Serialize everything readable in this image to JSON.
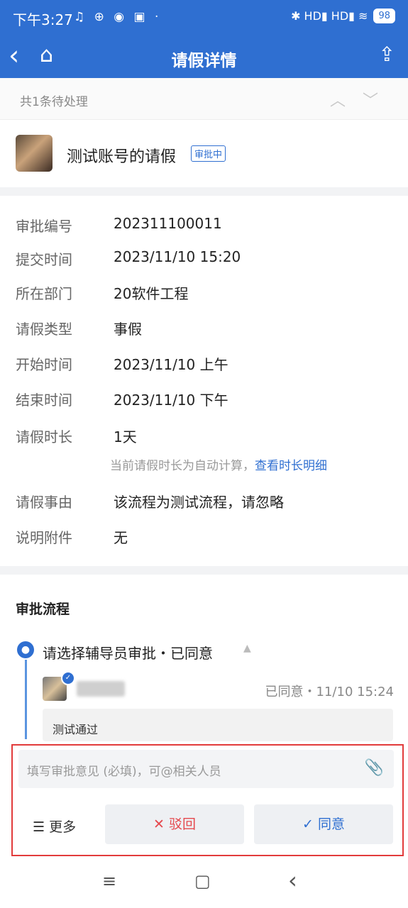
{
  "status_bar": {
    "time": "下午3:27",
    "left_icons": "♫ ⊕ ◉ ▣ ·",
    "right_icons": "✱ HD▮ HD▮ ≋",
    "battery": "98"
  },
  "header": {
    "title": "请假详情",
    "back_icon": "‹",
    "home_icon": "⌂",
    "share_icon": "⇪"
  },
  "pending": {
    "text": "共1条待处理",
    "up_icon": "︿",
    "down_icon": "﹀"
  },
  "request": {
    "title": "测试账号的请假",
    "status": "审批中"
  },
  "fields": [
    {
      "label": "审批编号",
      "value": "202311100011"
    },
    {
      "label": "提交时间",
      "value": "2023/11/10 15:20"
    },
    {
      "label": "所在部门",
      "value": "20软件工程"
    },
    {
      "label": "请假类型",
      "value": "事假"
    },
    {
      "label": "开始时间",
      "value": "2023/11/10 上午"
    },
    {
      "label": "结束时间",
      "value": "2023/11/10 下午"
    },
    {
      "label": "请假时长",
      "value": "1天"
    },
    {
      "label": "请假事由",
      "value": "该流程为测试流程，请忽略"
    },
    {
      "label": "说明附件",
      "value": "无"
    }
  ],
  "duration_note": {
    "text": "当前请假时长为自动计算，",
    "link": "查看时长明细"
  },
  "flow": {
    "title": "审批流程",
    "step_title": "请选择辅导员审批・已同意",
    "step_caret": "▲",
    "approver_status": "已同意・11/10 15:24",
    "comment": "测试通过"
  },
  "actions": {
    "opinion_placeholder": "填写审批意见 (必填)，可@相关人员",
    "more_label": "☰ 更多",
    "reject_label": "✕ 驳回",
    "agree_label": "✓ 同意"
  },
  "nav": {
    "menu": "≡",
    "home": "▢",
    "back": "‹"
  }
}
